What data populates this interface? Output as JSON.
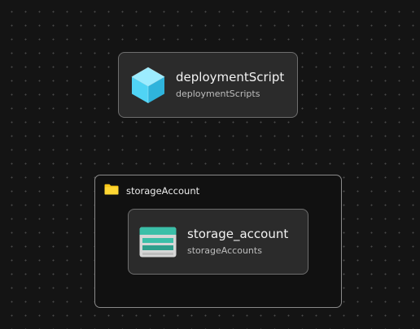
{
  "nodes": [
    {
      "title": "deploymentScript",
      "subtitle": "deploymentScripts",
      "icon": "cube-icon"
    },
    {
      "title": "storage_account",
      "subtitle": "storageAccounts",
      "icon": "storage-account-icon"
    }
  ],
  "groups": [
    {
      "label": "storageAccount",
      "icon": "folder-icon"
    }
  ],
  "colors": {
    "canvas_background": "#141414",
    "node_background": "#2b2b2b",
    "node_border": "#6e6e6e",
    "group_border": "#8a8a8a",
    "folder_icon": "#f5c518",
    "cube_icon": "#50d4f5",
    "storage_icon_bar": "#3bbfa8"
  }
}
